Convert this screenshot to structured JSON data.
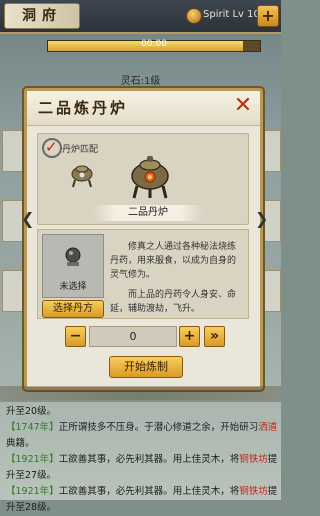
{
  "header": {
    "title": "洞府",
    "spirit_text": "Spirit Lv 10",
    "plus_label": "+"
  },
  "progress": {
    "value": 0.92,
    "text": "00:00"
  },
  "level_label": "灵石:1级",
  "modal": {
    "title": "二品炼丹炉",
    "close_label": "✕",
    "match_label": "丹炉匹配",
    "furnace_name": "二品丹炉",
    "slot_status": "未选择",
    "choose_label": "选择丹方",
    "description": [
      "修真之人通过各种秘法烧练丹药，用来服食，以成为自身的灵气修为。",
      "而上品的丹药令人身安、命延，辅助渡劫，飞升。"
    ],
    "quantity": "0",
    "minus_label": "−",
    "plus_label": "+",
    "max_label": "»",
    "start_label": "开始炼制"
  },
  "log": [
    {
      "year": "",
      "text": "升至20级。",
      "hl": "",
      "tail": ""
    },
    {
      "year": "【1747年】",
      "text": "正所谓技多不压身。于潜心修道之余，开始研习",
      "hl": "洒道",
      "tail": ""
    },
    {
      "year": "",
      "text": "典籍。",
      "hl": "",
      "tail": ""
    },
    {
      "year": "【1921年】",
      "text": "工欲善其事，必先利其器。用上佳灵木，将",
      "hl": "铜铁坊",
      "tail": "提"
    },
    {
      "year": "",
      "text": "升至27级。",
      "hl": "",
      "tail": ""
    },
    {
      "year": "【1921年】",
      "text": "工欲善其事，必先利其器。用上佳灵木，将",
      "hl": "铜铁坊",
      "tail": "提"
    },
    {
      "year": "",
      "text": "升至28级。",
      "hl": "",
      "tail": ""
    }
  ],
  "colors": {
    "accent": "#d99a27",
    "frame": "#b79a5a",
    "year": "#2d7a1f",
    "highlight": "#c0271a"
  }
}
